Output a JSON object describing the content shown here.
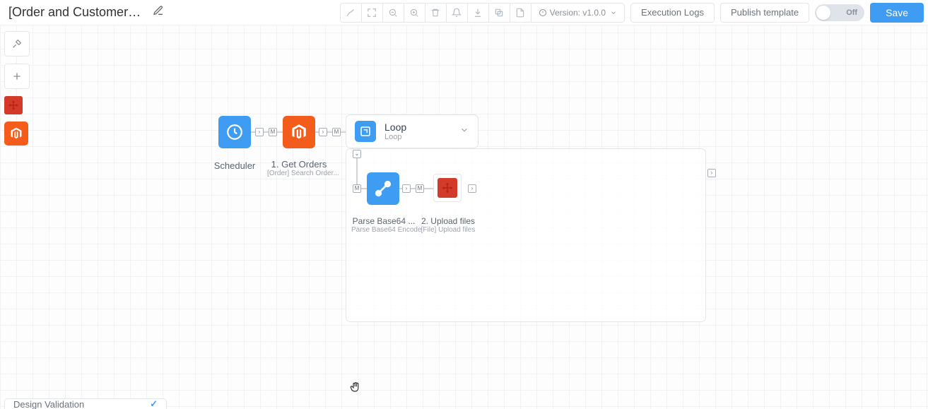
{
  "header": {
    "title": "[Order and Customer] ...",
    "version_label": "Version: v1.0.0",
    "exec_logs": "Execution Logs",
    "publish": "Publish template",
    "toggle_label": "Off",
    "save": "Save"
  },
  "footer": {
    "label": "Design Validation"
  },
  "nodes": {
    "scheduler": {
      "title": "Scheduler"
    },
    "get_orders": {
      "title": "1. Get Orders",
      "sub": "[Order] Search Order..."
    },
    "loop": {
      "title": "Loop",
      "sub": "Loop"
    },
    "parse": {
      "title": "Parse Base64 ...",
      "sub": "Parse Base64 Encode"
    },
    "upload": {
      "title": "2. Upload files",
      "sub": "[File] Upload files"
    }
  }
}
